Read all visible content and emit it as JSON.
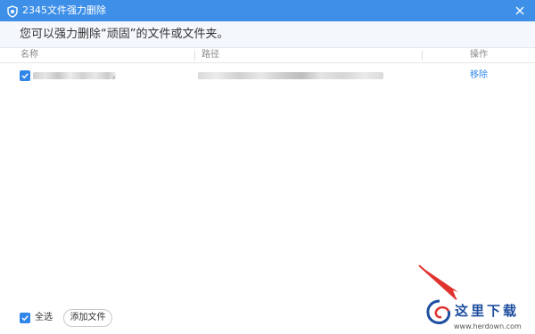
{
  "window": {
    "title": "2345文件强力删除",
    "accent_color": "#3d8fe8"
  },
  "info_bar": {
    "message": "您可以强力删除“顽固”的文件或文件夹。"
  },
  "table": {
    "columns": [
      "名称",
      "路径",
      "操作"
    ],
    "rows": [
      {
        "checked": true,
        "name": "",
        "path": "",
        "action_label": "移除"
      }
    ]
  },
  "footer": {
    "select_all_checked": true,
    "select_all_label": "全选",
    "add_file_label": "添加文件"
  },
  "watermark": {
    "brand_text": "这里下载",
    "url_text": "www.herdown.com"
  },
  "icons": {
    "app": "shield-icon",
    "close": "close-icon",
    "checkbox": "checkmark-icon"
  }
}
